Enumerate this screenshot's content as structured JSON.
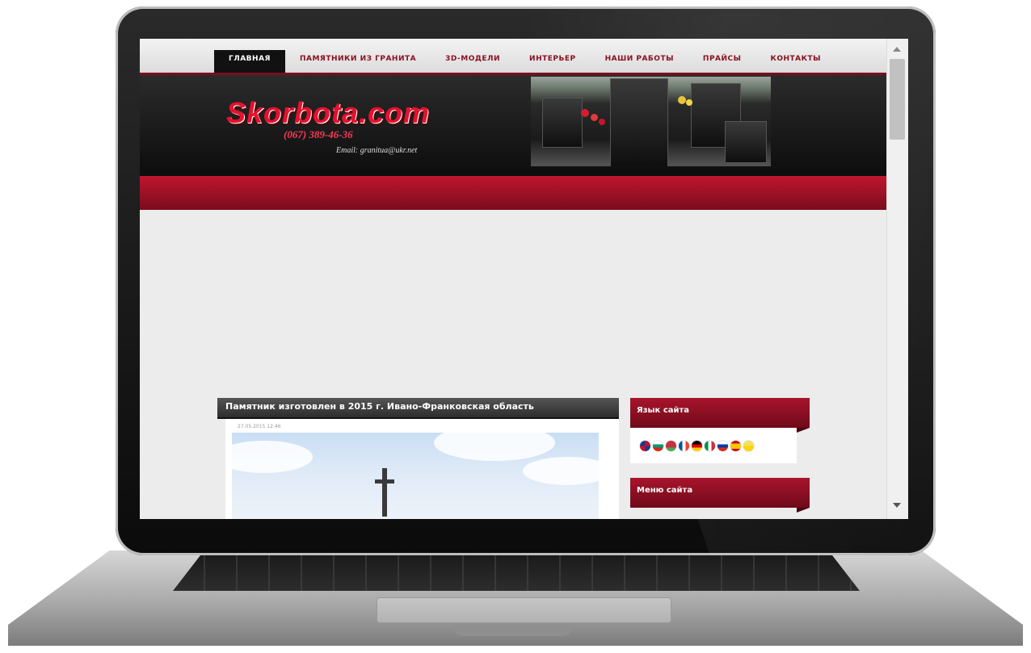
{
  "nav": {
    "items": [
      {
        "label": "ГЛАВНАЯ",
        "active": true
      },
      {
        "label": "ПАМЯТНИКИ ИЗ ГРАНИТА",
        "active": false
      },
      {
        "label": "3D-МОДЕЛИ",
        "active": false
      },
      {
        "label": "ИНТЕРЬЕР",
        "active": false
      },
      {
        "label": "НАШИ РАБОТЫ",
        "active": false
      },
      {
        "label": "ПРАЙСЫ",
        "active": false
      },
      {
        "label": "КОНТАКТЫ",
        "active": false
      }
    ]
  },
  "header": {
    "logo": "Skorbota.com",
    "phone": "(067) 389-46-36",
    "email": "Email: granitua@ukr.net"
  },
  "article": {
    "title": "Памятник изготовлен в 2015 г. Ивано-Франковская область",
    "date": "27.05.2015 12:46"
  },
  "sidebar": {
    "language_title": "Язык сайта",
    "menu_title": "Меню сайта",
    "flags": [
      "gb-flag",
      "bg-flag",
      "by-flag",
      "fr-flag",
      "de-flag",
      "it-flag",
      "ru-flag",
      "es-flag",
      "ua-flag"
    ]
  },
  "colors": {
    "accent": "#8a1022",
    "band": "#c0162f",
    "header_bg": "#0d0d0d"
  }
}
